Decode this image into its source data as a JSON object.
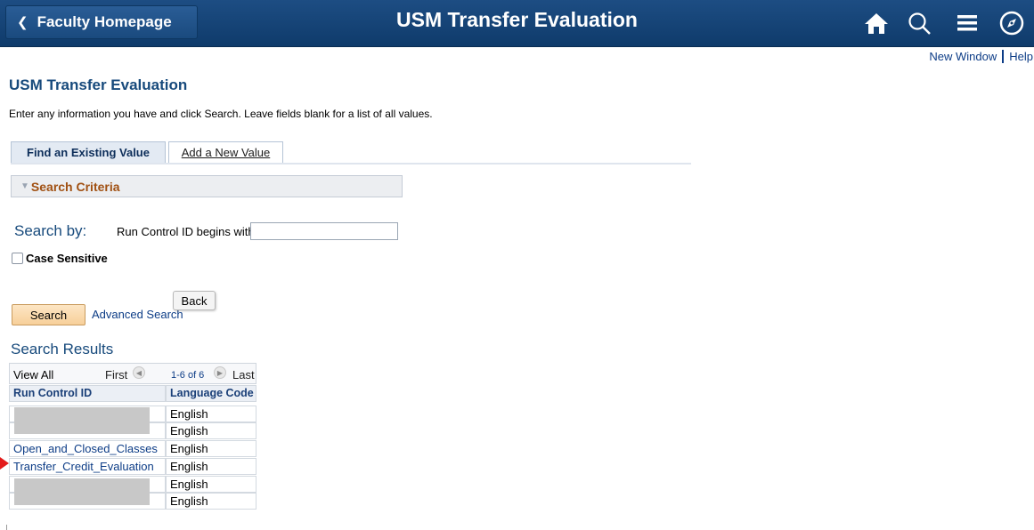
{
  "header": {
    "back_label": "Faculty Homepage",
    "title": "USM Transfer Evaluation",
    "icons": [
      "home-icon",
      "search-icon",
      "menu-icon",
      "navigator-icon"
    ]
  },
  "top_links": {
    "new_window": "New Window",
    "help": "Help"
  },
  "page": {
    "title": "USM Transfer Evaluation",
    "instructions": "Enter any information you have and click Search. Leave fields blank for a list of all values."
  },
  "tabs": [
    {
      "label": "Find an Existing Value",
      "active": true
    },
    {
      "label": "Add a New Value",
      "active": false
    }
  ],
  "search_criteria": {
    "label": "Search Criteria",
    "search_by_label": "Search by:",
    "field_label": "Run Control ID begins with",
    "field_value": "",
    "case_sensitive_label": "Case Sensitive",
    "case_sensitive_checked": false
  },
  "tooltip": "Back",
  "buttons": {
    "search": "Search",
    "advanced_search": "Advanced Search"
  },
  "results": {
    "title": "Search Results",
    "view_all": "View All",
    "first": "First",
    "count": "1-6 of 6",
    "last": "Last",
    "columns": [
      "Run Control ID",
      "Language Code"
    ],
    "rows": [
      {
        "id": "",
        "lang": "English",
        "redacted": true
      },
      {
        "id": "",
        "lang": "English",
        "redacted": true
      },
      {
        "id": "Open_and_Closed_Classes",
        "lang": "English",
        "redacted": false
      },
      {
        "id": "Transfer_Credit_Evaluation",
        "lang": "English",
        "redacted": false
      },
      {
        "id": "",
        "lang": "English",
        "redacted": true
      },
      {
        "id": "",
        "lang": "English",
        "redacted": true
      }
    ]
  },
  "colors": {
    "header_bg": "#0f3b6b",
    "link": "#0c3c86",
    "accent": "#174a7c",
    "annotation_arrow": "#e31b1b"
  }
}
